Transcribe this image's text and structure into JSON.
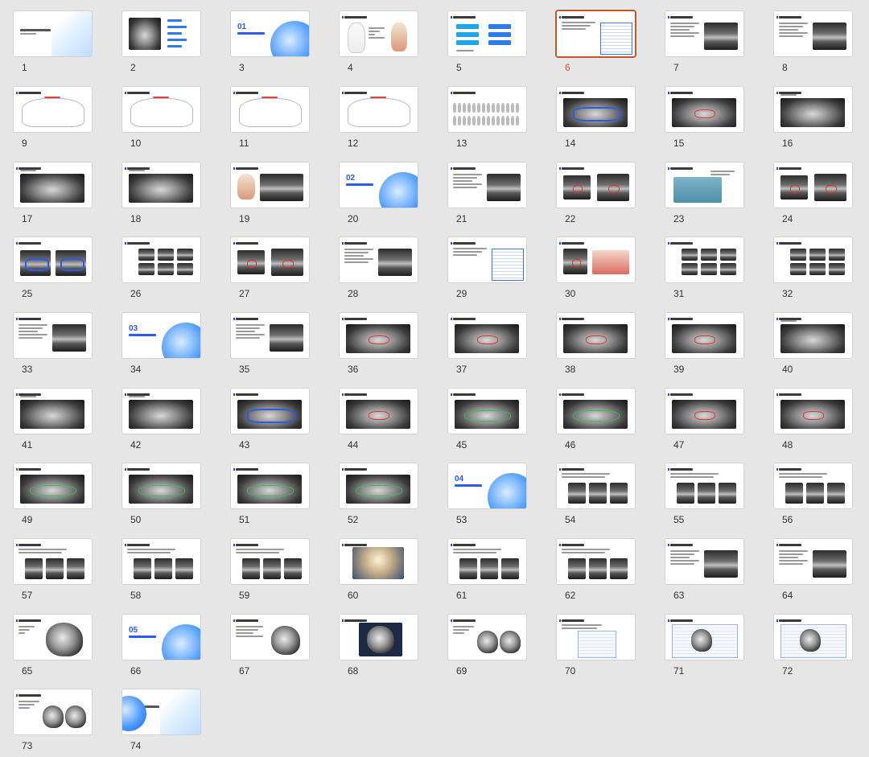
{
  "sorter": {
    "selected_slide": "6",
    "slides": [
      {
        "number": "1",
        "kind": "title"
      },
      {
        "number": "2",
        "kind": "toc"
      },
      {
        "number": "3",
        "kind": "section",
        "section_label": "01"
      },
      {
        "number": "4",
        "kind": "tooth-diagram"
      },
      {
        "number": "5",
        "kind": "flow"
      },
      {
        "number": "6",
        "kind": "table"
      },
      {
        "number": "7",
        "kind": "xray-text"
      },
      {
        "number": "8",
        "kind": "xray-text"
      },
      {
        "number": "9",
        "kind": "diagram"
      },
      {
        "number": "10",
        "kind": "diagram"
      },
      {
        "number": "11",
        "kind": "diagram"
      },
      {
        "number": "12",
        "kind": "diagram"
      },
      {
        "number": "13",
        "kind": "teeth-row"
      },
      {
        "number": "14",
        "kind": "pano-blue"
      },
      {
        "number": "15",
        "kind": "pano-red"
      },
      {
        "number": "16",
        "kind": "pano"
      },
      {
        "number": "17",
        "kind": "pano"
      },
      {
        "number": "18",
        "kind": "pano"
      },
      {
        "number": "19",
        "kind": "tooth-xray"
      },
      {
        "number": "20",
        "kind": "section",
        "section_label": "02"
      },
      {
        "number": "21",
        "kind": "xray-text"
      },
      {
        "number": "22",
        "kind": "xray-red"
      },
      {
        "number": "23",
        "kind": "photo"
      },
      {
        "number": "24",
        "kind": "xray-red"
      },
      {
        "number": "25",
        "kind": "xray-blue"
      },
      {
        "number": "26",
        "kind": "xray-grid"
      },
      {
        "number": "27",
        "kind": "xray-red"
      },
      {
        "number": "28",
        "kind": "xray-text"
      },
      {
        "number": "29",
        "kind": "table"
      },
      {
        "number": "30",
        "kind": "photo-red"
      },
      {
        "number": "31",
        "kind": "xray-grid"
      },
      {
        "number": "32",
        "kind": "xray-grid"
      },
      {
        "number": "33",
        "kind": "xray-text"
      },
      {
        "number": "34",
        "kind": "section",
        "section_label": "03"
      },
      {
        "number": "35",
        "kind": "xray-text"
      },
      {
        "number": "36",
        "kind": "pano-red"
      },
      {
        "number": "37",
        "kind": "pano-red"
      },
      {
        "number": "38",
        "kind": "pano-red"
      },
      {
        "number": "39",
        "kind": "pano-red"
      },
      {
        "number": "40",
        "kind": "pano"
      },
      {
        "number": "41",
        "kind": "pano"
      },
      {
        "number": "42",
        "kind": "pano"
      },
      {
        "number": "43",
        "kind": "pano-blue"
      },
      {
        "number": "44",
        "kind": "pano-red"
      },
      {
        "number": "45",
        "kind": "pano-green"
      },
      {
        "number": "46",
        "kind": "pano-green"
      },
      {
        "number": "47",
        "kind": "pano-red"
      },
      {
        "number": "48",
        "kind": "pano-red"
      },
      {
        "number": "49",
        "kind": "pano-green"
      },
      {
        "number": "50",
        "kind": "pano-green"
      },
      {
        "number": "51",
        "kind": "pano-green"
      },
      {
        "number": "52",
        "kind": "pano-green"
      },
      {
        "number": "53",
        "kind": "section",
        "section_label": "04"
      },
      {
        "number": "54",
        "kind": "ct-grid"
      },
      {
        "number": "55",
        "kind": "ct-grid"
      },
      {
        "number": "56",
        "kind": "ct-grid"
      },
      {
        "number": "57",
        "kind": "ct-grid"
      },
      {
        "number": "58",
        "kind": "ct-grid"
      },
      {
        "number": "59",
        "kind": "ct-grid"
      },
      {
        "number": "60",
        "kind": "render3d"
      },
      {
        "number": "61",
        "kind": "ct-grid"
      },
      {
        "number": "62",
        "kind": "ct-grid"
      },
      {
        "number": "63",
        "kind": "xray-text"
      },
      {
        "number": "64",
        "kind": "xray-text"
      },
      {
        "number": "65",
        "kind": "skull-small"
      },
      {
        "number": "66",
        "kind": "section",
        "section_label": "05"
      },
      {
        "number": "67",
        "kind": "skull"
      },
      {
        "number": "68",
        "kind": "skull-dark"
      },
      {
        "number": "69",
        "kind": "skull-pair"
      },
      {
        "number": "70",
        "kind": "screen"
      },
      {
        "number": "71",
        "kind": "screen-skull"
      },
      {
        "number": "72",
        "kind": "screen-skull"
      },
      {
        "number": "73",
        "kind": "skull-pair"
      },
      {
        "number": "74",
        "kind": "end"
      }
    ]
  }
}
